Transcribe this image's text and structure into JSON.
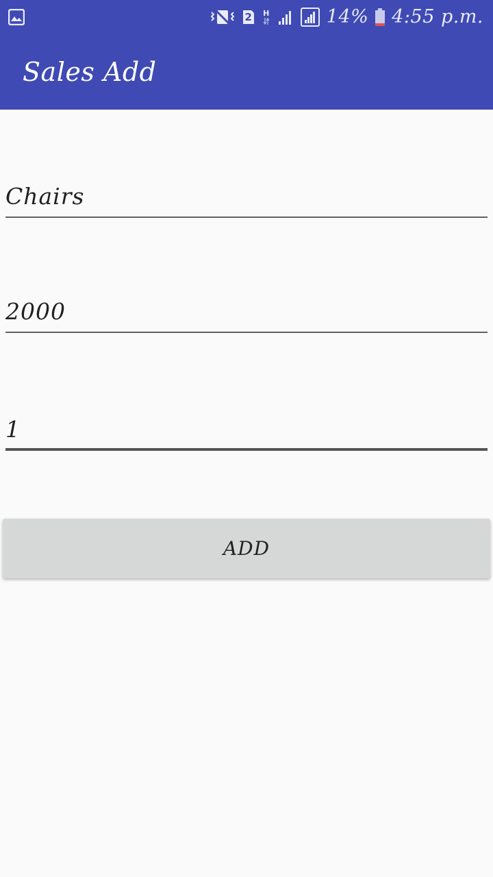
{
  "status_bar": {
    "battery_percent": "14%",
    "time": "4:55 p.m.",
    "sim_badge": "2",
    "network_type": "H",
    "icons": [
      "gallery-notification-icon",
      "vibrate-mute-icon",
      "sim2-icon",
      "h-data-icon",
      "signal-icon",
      "signal-icon-2",
      "battery-icon"
    ],
    "background_color": "#3f4ab4"
  },
  "app_bar": {
    "title": "Sales Add",
    "background_color": "#3f4ab4"
  },
  "form": {
    "product_name": {
      "value": "Chairs",
      "placeholder": ""
    },
    "price": {
      "value": "2000",
      "placeholder": ""
    },
    "quantity": {
      "value": "1",
      "placeholder": ""
    }
  },
  "actions": {
    "add_label": "ADD"
  },
  "colors": {
    "page_background": "#fafafa",
    "button_background": "#d6d7d7",
    "underline": "#616161"
  }
}
